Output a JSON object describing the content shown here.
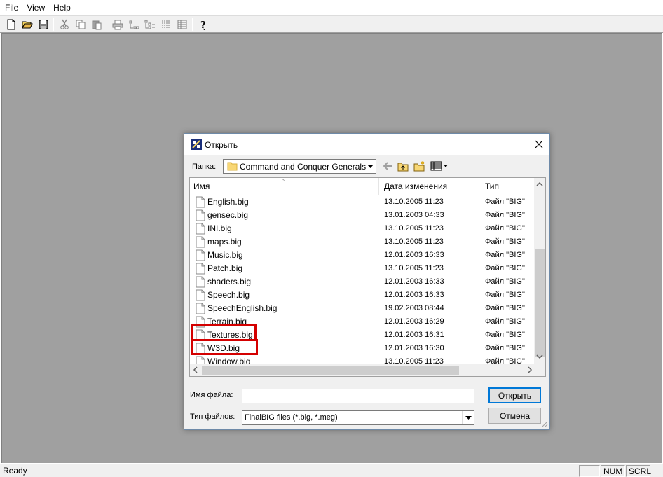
{
  "menu": {
    "items": [
      "File",
      "View",
      "Help"
    ]
  },
  "toolbar": {
    "buttons": [
      "new-file-icon",
      "open-folder-icon",
      "save-icon",
      "cut-icon",
      "copy-icon",
      "paste-icon",
      "print-icon",
      "add-file-icon",
      "add-folder-icon",
      "details-view-icon",
      "list-view-icon",
      "help-icon"
    ]
  },
  "status": {
    "text": "Ready",
    "num": "NUM",
    "scrl": "SCRL"
  },
  "dialog": {
    "title": "Открыть",
    "look_in_label": "Папка:",
    "look_in_value": "Command and Conquer Generals",
    "columns": {
      "name": "Имя",
      "date": "Дата изменения",
      "type": "Тип"
    },
    "files": [
      {
        "name": "English.big",
        "date": "13.10.2005 11:23",
        "type": "Файл \"BIG\""
      },
      {
        "name": "gensec.big",
        "date": "13.01.2003 04:33",
        "type": "Файл \"BIG\""
      },
      {
        "name": "INI.big",
        "date": "13.10.2005 11:23",
        "type": "Файл \"BIG\""
      },
      {
        "name": "maps.big",
        "date": "13.10.2005 11:23",
        "type": "Файл \"BIG\""
      },
      {
        "name": "Music.big",
        "date": "12.01.2003 16:33",
        "type": "Файл \"BIG\""
      },
      {
        "name": "Patch.big",
        "date": "13.10.2005 11:23",
        "type": "Файл \"BIG\""
      },
      {
        "name": "shaders.big",
        "date": "12.01.2003 16:33",
        "type": "Файл \"BIG\""
      },
      {
        "name": "Speech.big",
        "date": "12.01.2003 16:33",
        "type": "Файл \"BIG\""
      },
      {
        "name": "SpeechEnglish.big",
        "date": "19.02.2003 08:44",
        "type": "Файл \"BIG\""
      },
      {
        "name": "Terrain.big",
        "date": "12.01.2003 16:29",
        "type": "Файл \"BIG\""
      },
      {
        "name": "Textures.big",
        "date": "12.01.2003 16:31",
        "type": "Файл \"BIG\""
      },
      {
        "name": "W3D.big",
        "date": "12.01.2003 16:30",
        "type": "Файл \"BIG\""
      },
      {
        "name": "Window.big",
        "date": "13.10.2005 11:23",
        "type": "Файл \"BIG\""
      }
    ],
    "filename_label": "Имя файла:",
    "filename_value": "",
    "filetype_label": "Тип файлов:",
    "filetype_value": "FinalBIG files (*.big, *.meg)",
    "open_button": "Открыть",
    "cancel_button": "Отмена"
  },
  "colors": {
    "highlight": "#d40000",
    "workspace": "#a0a0a0",
    "default_button_border": "#0078d7"
  }
}
